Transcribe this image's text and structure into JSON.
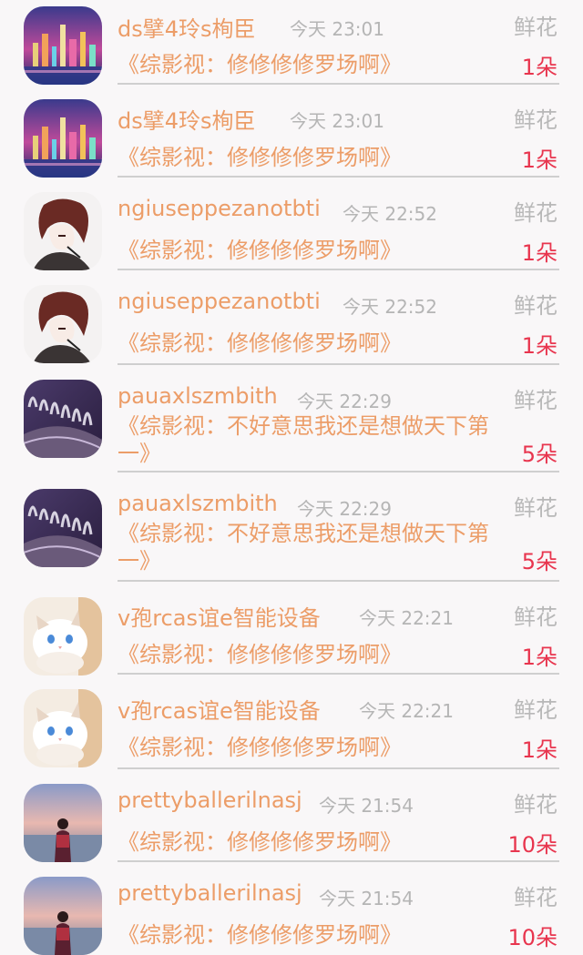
{
  "gift_records": [
    {
      "user": "ds擘4玲s栒臣",
      "time": "今天 23:01",
      "gift": "鲜花",
      "work": "《综影视：修修修修罗场啊》",
      "count": "1朵",
      "avatar": "city-night"
    },
    {
      "user": "ds擘4玲s栒臣",
      "time": "今天 23:01",
      "gift": "鲜花",
      "work": "《综影视：修修修修罗场啊》",
      "count": "1朵",
      "avatar": "city-night"
    },
    {
      "user": "ngiuseppezanotbti",
      "time": "今天 22:52",
      "gift": "鲜花",
      "work": "《综影视：修修修修罗场啊》",
      "count": "1朵",
      "avatar": "anime-boy"
    },
    {
      "user": "ngiuseppezanotbti",
      "time": "今天 22:52",
      "gift": "鲜花",
      "work": "《综影视：修修修修罗场啊》",
      "count": "1朵",
      "avatar": "anime-boy"
    },
    {
      "user": "pauaxlszmbith",
      "time": "今天 22:29",
      "gift": "鲜花",
      "work": "《综影视：不好意思我还是想做天下第一》",
      "count": "5朵",
      "avatar": "fountain"
    },
    {
      "user": "pauaxlszmbith",
      "time": "今天 22:29",
      "gift": "鲜花",
      "work": "《综影视：不好意思我还是想做天下第一》",
      "count": "5朵",
      "avatar": "fountain"
    },
    {
      "user": "v孢rcas谊e智能设备",
      "time": "今天 22:21",
      "gift": "鲜花",
      "work": "《综影视：修修修修罗场啊》",
      "count": "1朵",
      "avatar": "cat"
    },
    {
      "user": "v孢rcas谊e智能设备",
      "time": "今天 22:21",
      "gift": "鲜花",
      "work": "《综影视：修修修修罗场啊》",
      "count": "1朵",
      "avatar": "cat"
    },
    {
      "user": "prettyballerilnasj",
      "time": "今天 21:54",
      "gift": "鲜花",
      "work": "《综影视：修修修修罗场啊》",
      "count": "10朵",
      "avatar": "sunset-person"
    },
    {
      "user": "prettyballerilnasj",
      "time": "今天 21:54",
      "gift": "鲜花",
      "work": "《综影视：修修修修罗场啊》",
      "count": "10朵",
      "avatar": "sunset-person"
    }
  ]
}
